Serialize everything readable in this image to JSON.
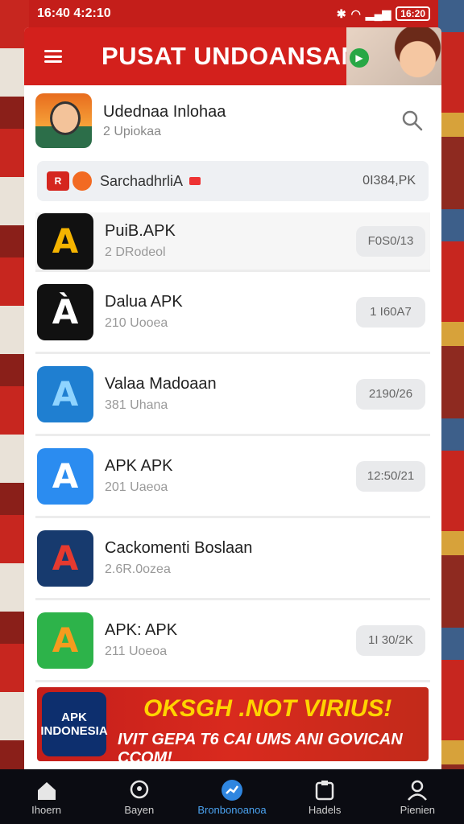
{
  "status_bar": {
    "time": "16:40 4:2:10",
    "battery": "16:20"
  },
  "header": {
    "title": "PUSAT UNDOANSAN"
  },
  "profile": {
    "name": "Udednaa Inlohaa",
    "sub": "2 Upiokaa"
  },
  "search": {
    "text": "SarchadhrliА",
    "value": "0I384,PK"
  },
  "apps": [
    {
      "name": "PuiB.APK",
      "sub": "2 DRodeol",
      "btn": "F0S0/13",
      "icon_glyph": "A",
      "icon_bg": "#111111",
      "icon_fg": "#f5b400"
    },
    {
      "name": "Dalua APK",
      "sub": "210 Uooea",
      "btn": "1 I60A7",
      "icon_glyph": "À",
      "icon_bg": "#111111",
      "icon_fg": "#ffffff"
    },
    {
      "name": "Valaa Madoaan",
      "sub": "381 Uhana",
      "btn": "2190/26",
      "icon_glyph": "A",
      "icon_bg": "#1f7fd1",
      "icon_fg": "#8fd4ff"
    },
    {
      "name": "APK APK",
      "sub": "201 Uaeoa",
      "btn": "12:50/21",
      "icon_glyph": "A",
      "icon_bg": "#2b8cf0",
      "icon_fg": "#ffffff"
    },
    {
      "name": "Cackomenti Boslaan",
      "sub": "2.6R.0ozea",
      "btn": "",
      "icon_glyph": "A",
      "icon_bg": "#173a6e",
      "icon_fg": "#e53a2f"
    },
    {
      "name": "APK: APK",
      "sub": "211 Uoeoa",
      "btn": "1I 30/2K",
      "icon_glyph": "A",
      "icon_bg": "#2db34a",
      "icon_fg": "#f59b1e"
    }
  ],
  "banner": {
    "logo": "APK INDONESIA",
    "headline": "OKSGH .NOT VIRIUS!",
    "subline": "IVIT GEPA T6 CAI UMS ANI GOVICAN CCOM!"
  },
  "nav": [
    {
      "label": "Ihoern",
      "icon": "home-icon"
    },
    {
      "label": "Bayen",
      "icon": "location-icon"
    },
    {
      "label": "Bronbonoanoa",
      "icon": "chart-icon",
      "active": true
    },
    {
      "label": "Hadels",
      "icon": "apps-icon"
    },
    {
      "label": "Pienien",
      "icon": "profile-icon"
    }
  ]
}
